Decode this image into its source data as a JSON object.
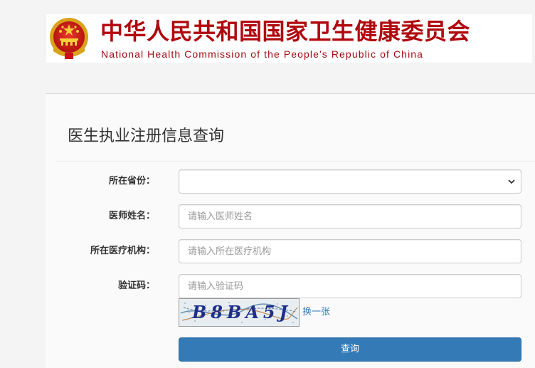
{
  "header": {
    "org_name_cn": "中华人民共和国国家卫生健康委员会",
    "org_name_en": "National Health Commission of the People′s Republic of China",
    "emblem_icon": "national-emblem-icon"
  },
  "page": {
    "title": "医生执业注册信息查询"
  },
  "form": {
    "province": {
      "label": "所在省份：",
      "selected": ""
    },
    "doctor_name": {
      "label": "医师姓名：",
      "value": "",
      "placeholder": "请输入医师姓名"
    },
    "institution": {
      "label": "所在医疗机构：",
      "value": "",
      "placeholder": "请输入所在医疗机构"
    },
    "captcha": {
      "label": "验证码：",
      "value": "",
      "placeholder": "请输入验证码",
      "image_text": "B8BA5J",
      "refresh_label": "换一张"
    },
    "submit_label": "查询"
  },
  "colors": {
    "brand_red": "#b0080d",
    "primary_button": "#337ab7",
    "link": "#337ab7",
    "background": "#f4f4f4"
  }
}
